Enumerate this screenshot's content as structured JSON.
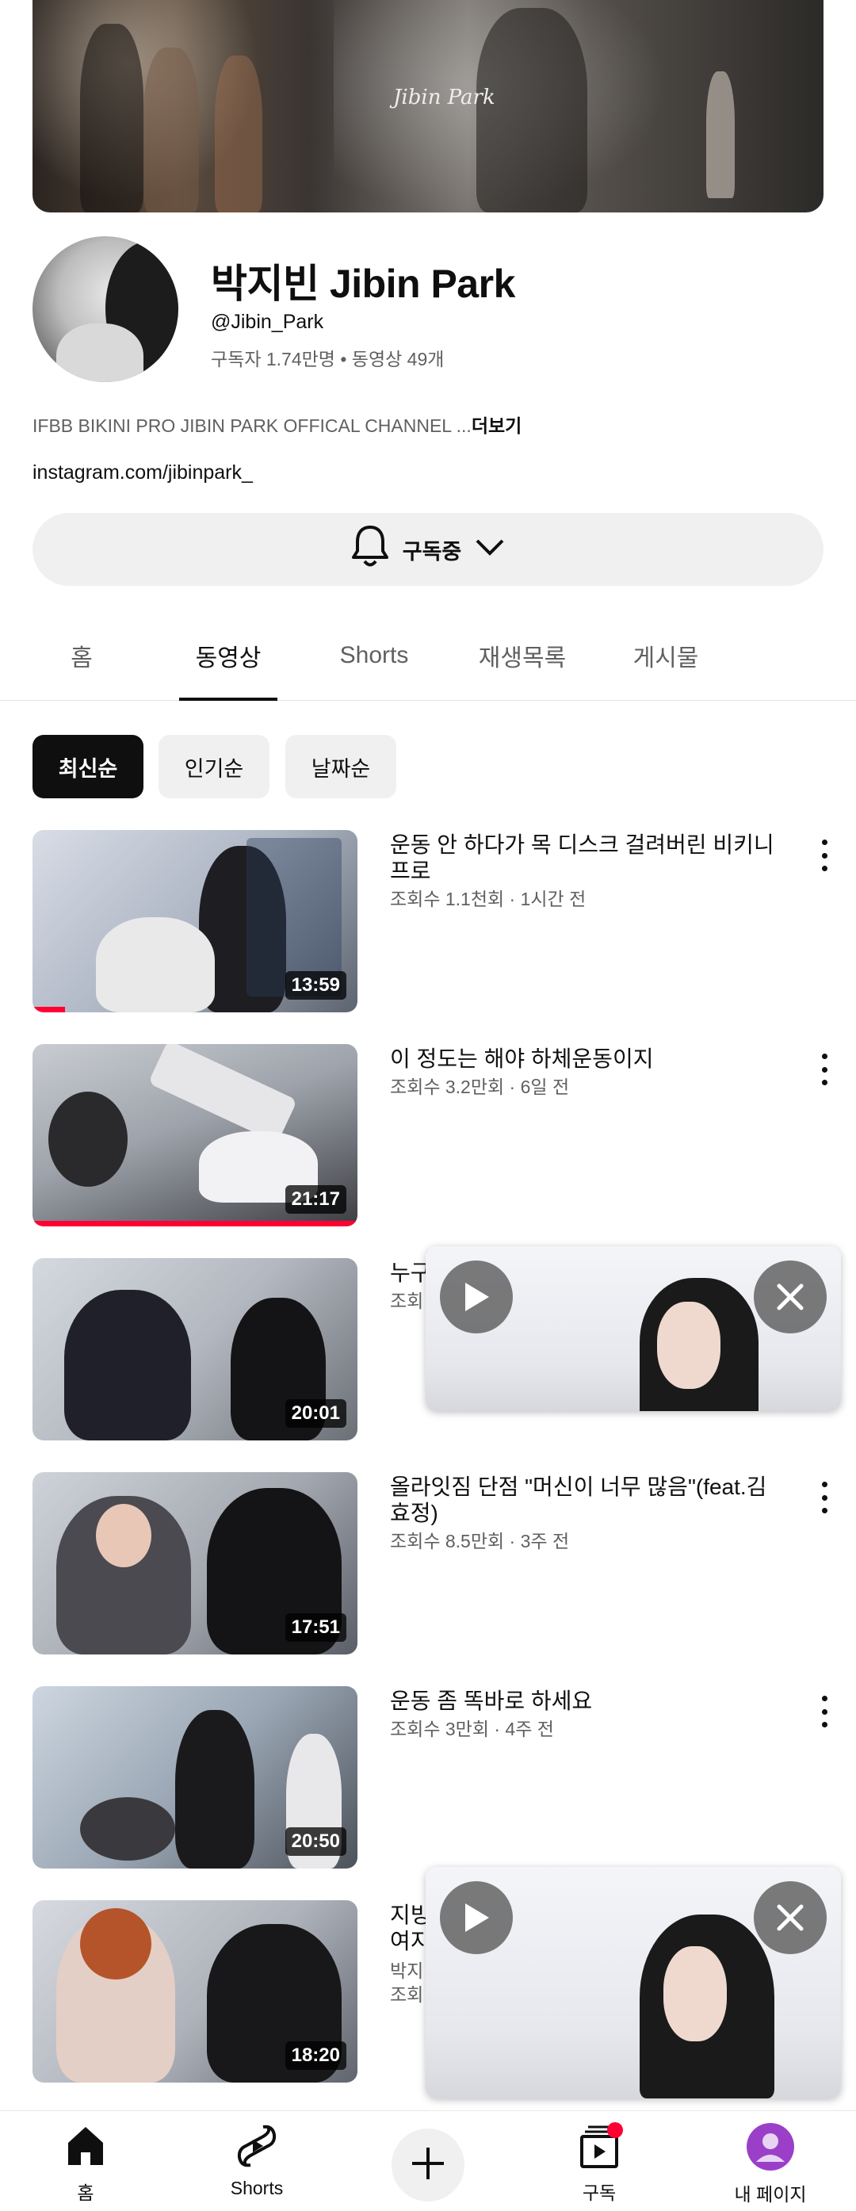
{
  "channel": {
    "name": "박지빈 Jibin Park",
    "handle": "@Jibin_Park",
    "stats": "구독자 1.74만명 • 동영상 49개",
    "description": "IFBB BIKINI PRO JIBIN PARK OFFICAL CHANNEL ...",
    "description_more": "더보기",
    "link": "instagram.com/jibinpark_",
    "banner_signature": "Jibin Park"
  },
  "subscribe_button": {
    "label": "구독중"
  },
  "tabs": [
    {
      "label": "홈",
      "active": false
    },
    {
      "label": "동영상",
      "active": true
    },
    {
      "label": "Shorts",
      "active": false
    },
    {
      "label": "재생목록",
      "active": false
    },
    {
      "label": "게시물",
      "active": false
    }
  ],
  "filters": [
    {
      "label": "최신순",
      "active": true
    },
    {
      "label": "인기순",
      "active": false
    },
    {
      "label": "날짜순",
      "active": false
    }
  ],
  "videos": [
    {
      "title": "운동 안 하다가 목 디스크 걸려버린 비키니 프로",
      "meta": "조회수 1.1천회 · 1시간 전",
      "duration": "13:59",
      "watched_fraction": 0.1
    },
    {
      "title": "이 정도는 해야 하체운동이지",
      "meta": "조회수 3.2만회 · 6일 전",
      "duration": "21:17",
      "watched_fraction": 1.0
    },
    {
      "title": "누구",
      "meta": "조회",
      "duration": "20:01"
    },
    {
      "title": "올라잇짐 단점 \"머신이 너무 많음\"(feat.김효정)",
      "meta": "조회수 8.5만회 · 3주 전",
      "duration": "17:51"
    },
    {
      "title": "운동 좀 똑바로 하세요",
      "meta": "조회수 3만회 · 4주 전",
      "duration": "20:50"
    },
    {
      "title_line1": "지빙",
      "title_line2": "여지",
      "channel_partial": "박지",
      "meta": "조회",
      "duration": "18:20"
    }
  ],
  "bottom_nav": {
    "home": "홈",
    "shorts": "Shorts",
    "subscriptions": "구독",
    "profile": "내 페이지"
  },
  "colors": {
    "accent_red": "#ff0033",
    "chip_active": "#0f0f0f",
    "secondary_text": "#606060",
    "profile_purple": "#9b3fc9"
  }
}
